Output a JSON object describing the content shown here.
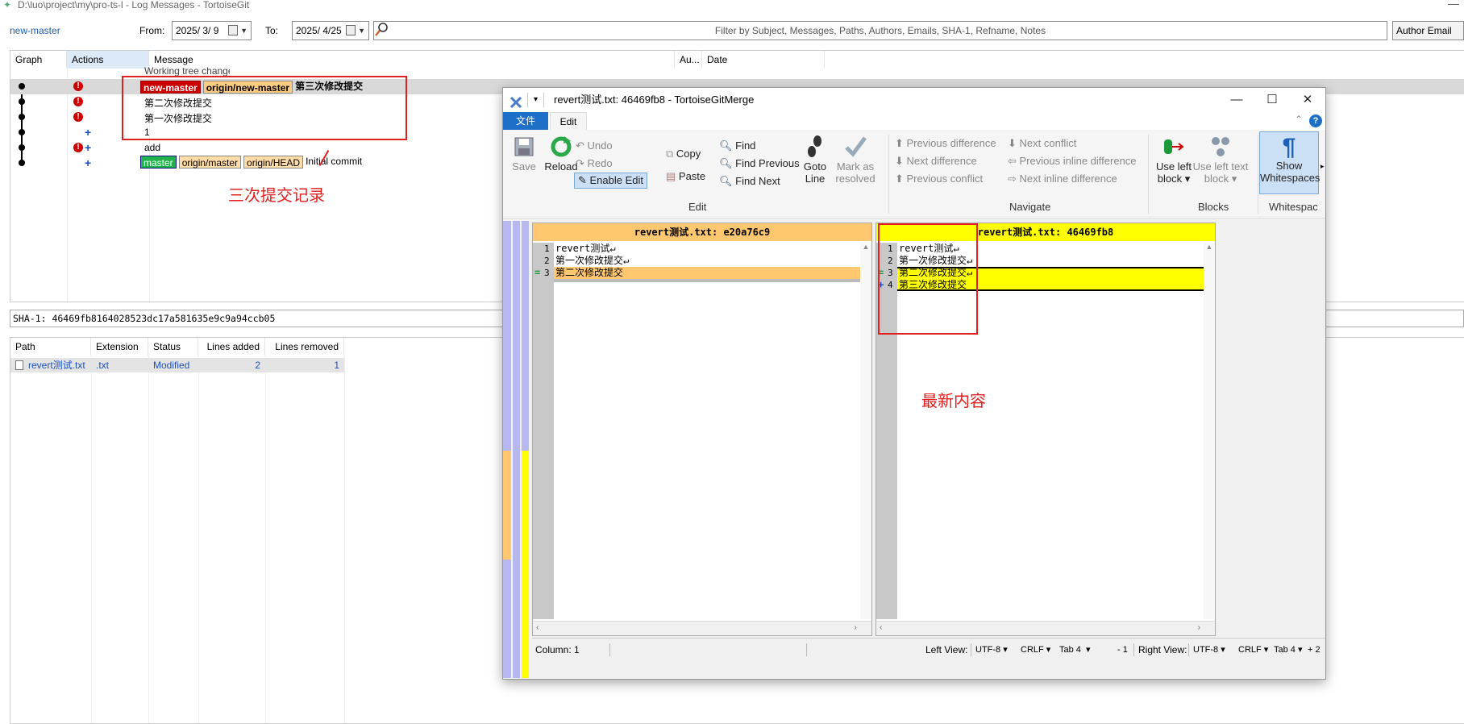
{
  "log_window": {
    "title": "D:\\luo\\project\\my\\pro-ts-l - Log Messages - TortoiseGit",
    "branch": "new-master",
    "from_label": "From:",
    "from_date": "2025/ 3/ 9",
    "to_label": "To:",
    "to_date": "2025/ 4/25",
    "filter_placeholder": "Filter by Subject, Messages, Paths, Authors, Emails, SHA-1, Refname, Notes",
    "author_email_btn": "Author Email",
    "columns": [
      "Graph",
      "Actions",
      "Message",
      "Au...",
      "Date"
    ],
    "working_tree": "Working tree changes",
    "rows": [
      {
        "tags": [
          "new-master",
          "origin/new-master"
        ],
        "message": "第三次修改提交"
      },
      {
        "tags": [],
        "message": "第二次修改提交"
      },
      {
        "tags": [],
        "message": "第一次修改提交"
      },
      {
        "tags": [],
        "message": "1"
      },
      {
        "tags": [],
        "message": "add"
      },
      {
        "tags": [
          "master",
          "origin/master",
          "origin/HEAD"
        ],
        "message": "Initial commit"
      }
    ],
    "annotation_commits": "三次提交记录",
    "sha": "SHA-1: 46469fb8164028523dc17a581635e9c9a94ccb05",
    "file_columns": [
      "Path",
      "Extension",
      "Status",
      "Lines added",
      "Lines removed"
    ],
    "files": [
      {
        "path": "revert测试.txt",
        "ext": ".txt",
        "status": "Modified",
        "added": "2",
        "removed": "1"
      }
    ]
  },
  "merge_window": {
    "title": "revert测试.txt: 46469fb8 - TortoiseGitMerge",
    "tab_file": "文件",
    "tab_edit": "Edit",
    "ribbon": {
      "save": "Save",
      "reload": "Reload",
      "undo": "Undo",
      "redo": "Redo",
      "enable_edit": "Enable Edit",
      "copy": "Copy",
      "paste": "Paste",
      "find": "Find",
      "find_previous": "Find Previous",
      "find_next": "Find Next",
      "goto_line_1": "Goto",
      "goto_line_2": "Line",
      "mark_1": "Mark as",
      "mark_2": "resolved",
      "prev_diff": "Previous difference",
      "next_diff": "Next difference",
      "prev_conflict": "Previous conflict",
      "next_conflict": "Next conflict",
      "prev_inline": "Previous inline difference",
      "next_inline": "Next inline difference",
      "use_left_block_1": "Use left",
      "use_left_block_2": "block ▾",
      "use_left_text_1": "Use left text",
      "use_left_text_2": "block ▾",
      "show_ws_1": "Show",
      "show_ws_2": "Whitespaces",
      "group_edit": "Edit",
      "group_navigate": "Navigate",
      "group_blocks": "Blocks",
      "group_ws": "Whitespac"
    },
    "left_pane": {
      "header": "revert测试.txt: e20a76c9",
      "lines": [
        {
          "num": "1",
          "mark": "",
          "text": "revert测试↵"
        },
        {
          "num": "2",
          "mark": "",
          "text": "第一次修改提交↵"
        },
        {
          "num": "3",
          "mark": "=",
          "text": "第二次修改提交"
        }
      ]
    },
    "right_pane": {
      "header": "revert测试.txt: 46469fb8",
      "lines": [
        {
          "num": "1",
          "mark": "",
          "text": "revert测试↵"
        },
        {
          "num": "2",
          "mark": "",
          "text": "第一次修改提交↵"
        },
        {
          "num": "3",
          "mark": "=",
          "text": "第二次修改提交↵"
        },
        {
          "num": "4",
          "mark": "+",
          "text": "第三次修改提交"
        }
      ]
    },
    "annotation_latest": "最新内容",
    "status": {
      "column": "Column: 1",
      "left_view": "Left View:",
      "left_enc": "UTF-8",
      "left_eol": "CRLF",
      "left_tab": "Tab 4",
      "left_delta": "- 1",
      "right_view": "Right View:",
      "right_enc": "UTF-8",
      "right_eol": "CRLF",
      "right_tab": "Tab 4",
      "right_delta": "+ 2"
    }
  },
  "colors": {
    "accent": "#1e6fc8",
    "annotation": "#e02020",
    "left_changed": "#ffc870",
    "right_changed": "#ffff00"
  }
}
